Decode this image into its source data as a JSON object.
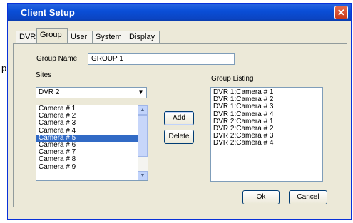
{
  "window": {
    "title": "Client Setup",
    "close_glyph": "✕"
  },
  "stray_text": "p",
  "tabs": [
    {
      "label": "DVR",
      "active": false
    },
    {
      "label": "Group",
      "active": true
    },
    {
      "label": "User",
      "active": false
    },
    {
      "label": "System",
      "active": false
    },
    {
      "label": "Display",
      "active": false
    }
  ],
  "group_name": {
    "label": "Group Name",
    "value": "GROUP 1"
  },
  "sites": {
    "label": "Sites",
    "selected": "DVR 2",
    "arrow": "▼"
  },
  "cameras": {
    "items": [
      "Camera # 1",
      "Camera # 2",
      "Camera # 3",
      "Camera # 4",
      "Camera # 5",
      "Camera # 6",
      "Camera # 7",
      "Camera # 8",
      "Camera # 9"
    ],
    "selected_index": 4,
    "scroll_up": "▲",
    "scroll_down": "▼"
  },
  "buttons": {
    "add": "Add",
    "delete": "Delete",
    "ok": "Ok",
    "cancel": "Cancel"
  },
  "group_listing": {
    "label": "Group Listing",
    "items": [
      "DVR 1:Camera # 1",
      "DVR 1:Camera # 2",
      "DVR 1:Camera # 3",
      "DVR 1:Camera # 4",
      "DVR 2:Camera # 1",
      "DVR 2:Camera # 2",
      "DVR 2:Camera # 3",
      "DVR 2:Camera # 4"
    ]
  },
  "colors": {
    "titlebar": "#0a4fd8",
    "selection": "#316ac5",
    "window_bg": "#ece9d8",
    "close": "#c9391a"
  }
}
